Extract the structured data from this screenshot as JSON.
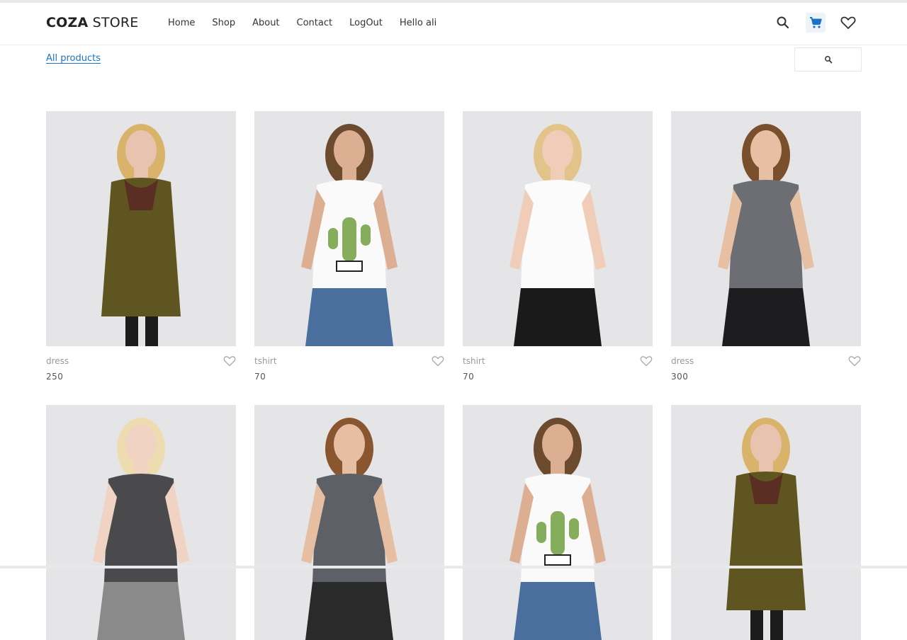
{
  "brand": {
    "bold": "COZA",
    "light": " STORE"
  },
  "nav": [
    {
      "label": "Home"
    },
    {
      "label": "Shop"
    },
    {
      "label": "About"
    },
    {
      "label": "Contact"
    },
    {
      "label": "LogOut"
    },
    {
      "label": "Hello ali"
    }
  ],
  "header_icons": [
    "search-icon",
    "cart-icon",
    "heart-icon"
  ],
  "colors": {
    "accent": "#1a73c8",
    "cart_bg": "#eef3f8",
    "image_bg": "#e6e6e8"
  },
  "filter": {
    "label": "All products"
  },
  "products": [
    {
      "name": "dress",
      "price": "250",
      "figure": "coat"
    },
    {
      "name": "tshirt",
      "price": "70",
      "figure": "cactus-tee"
    },
    {
      "name": "tshirt",
      "price": "70",
      "figure": "white-tee"
    },
    {
      "name": "dress",
      "price": "300",
      "figure": "denim-skirt"
    },
    {
      "name": "",
      "price": "",
      "figure": "grey-tee"
    },
    {
      "name": "",
      "price": "",
      "figure": "grey-shirt"
    },
    {
      "name": "",
      "price": "",
      "figure": "cactus-tee"
    },
    {
      "name": "",
      "price": "",
      "figure": "coat"
    }
  ]
}
